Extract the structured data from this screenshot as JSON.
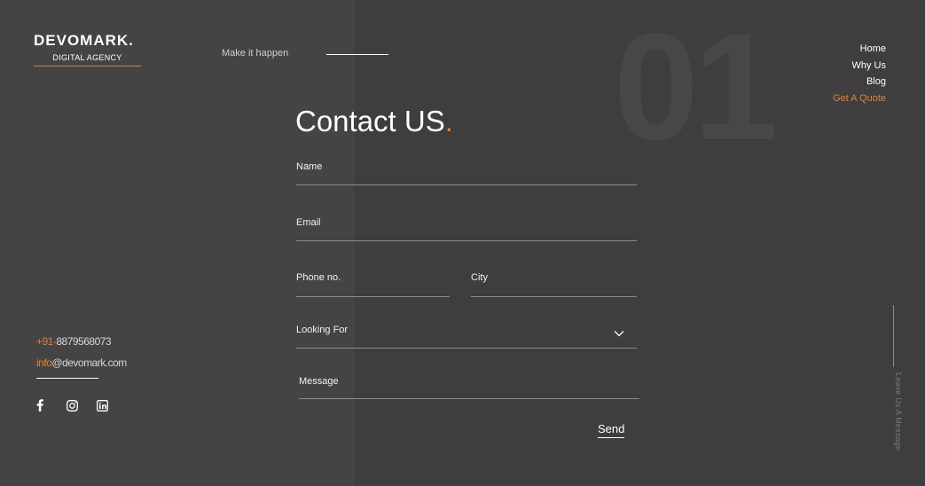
{
  "logo": {
    "word": "DEVOMARK.",
    "tagline": "DIGITAL AGENCY"
  },
  "header": {
    "tagline": "Make it happen",
    "big_number": "01"
  },
  "nav": {
    "items": [
      {
        "label": "Home"
      },
      {
        "label": "Why Us"
      },
      {
        "label": "Blog"
      },
      {
        "label": "Get A Quote"
      }
    ]
  },
  "form": {
    "title": "Contact US",
    "title_dot": ".",
    "name_label": "Name",
    "email_label": "Email",
    "phone_label": "Phone no.",
    "city_label": "City",
    "looking_for_label": "Looking For",
    "message_label": "Message",
    "send_label": "Send"
  },
  "contact": {
    "phone_prefix": "+91-",
    "phone_number": "8879568073",
    "email_prefix": "info",
    "email_domain": "@devomark.com"
  },
  "social": {
    "icons": [
      "facebook-icon",
      "instagram-icon",
      "linkedin-icon"
    ]
  },
  "side": {
    "text": "Leave Us A Message"
  },
  "colors": {
    "accent": "#e0822f",
    "left_bg": "#444444",
    "right_bg": "#3e3e3e"
  }
}
